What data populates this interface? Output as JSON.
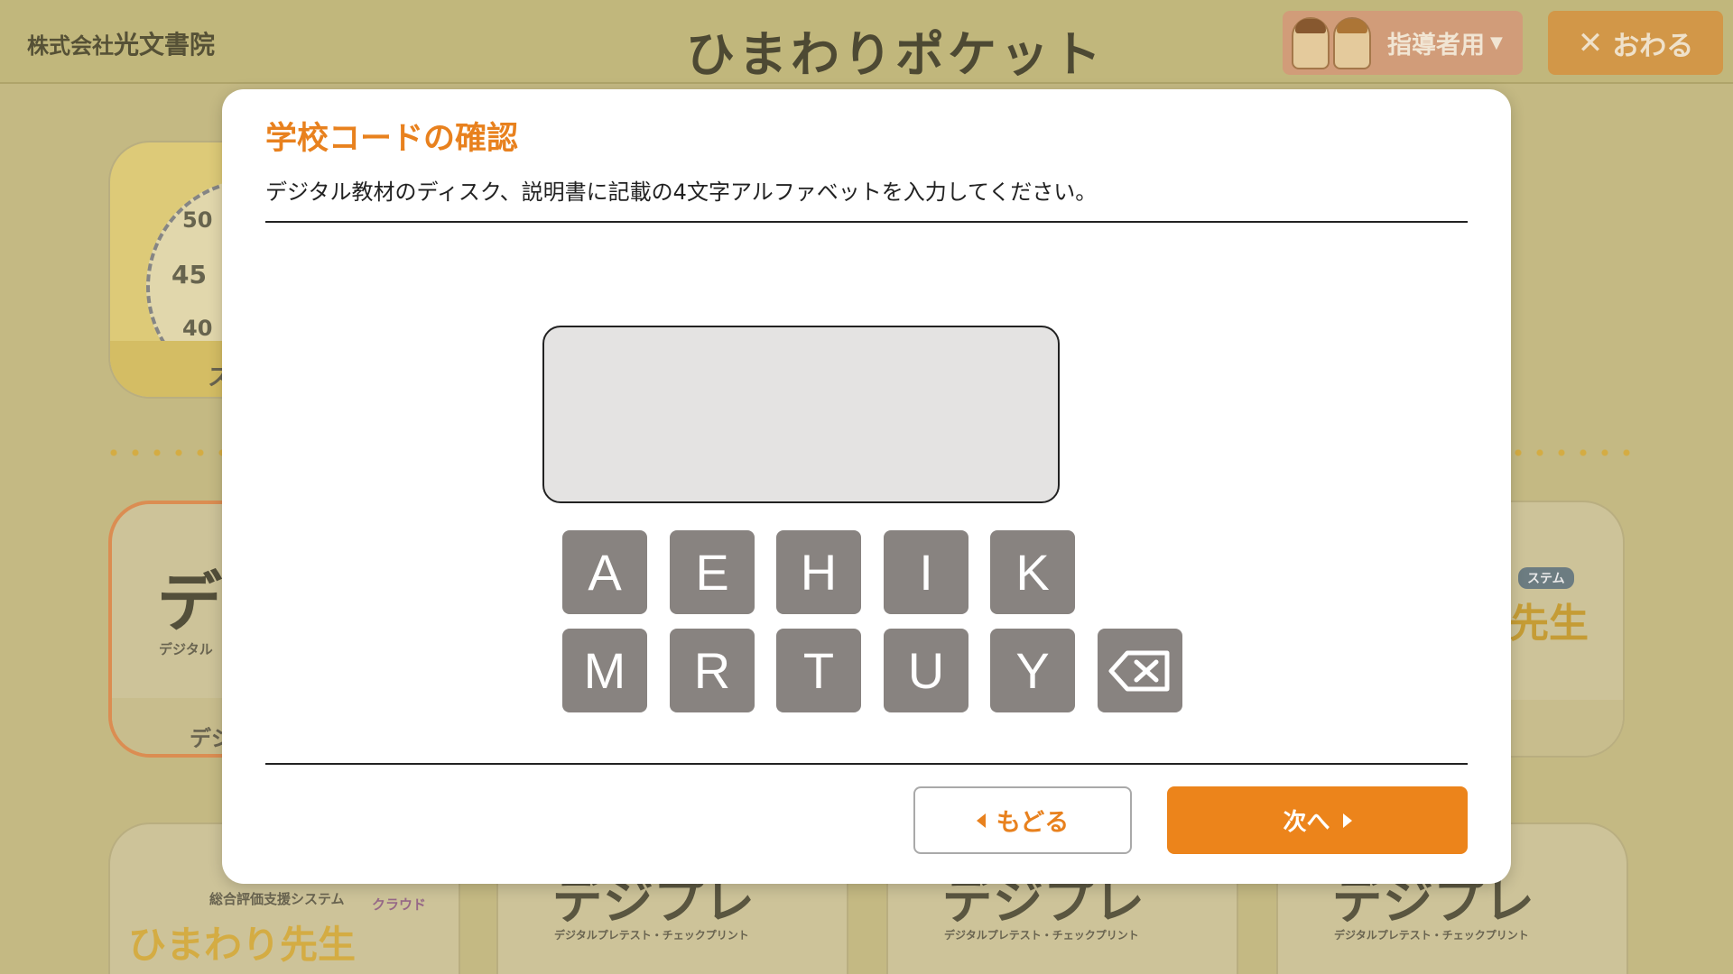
{
  "header": {
    "publisher_small": "株式会社",
    "publisher_name": "光文書院",
    "logo": "ひまわりポケット",
    "teacher_label": "指導者用",
    "close_label": "おわる"
  },
  "background": {
    "dial_labels": [
      "50",
      "45",
      "40"
    ],
    "tile_fragments": {
      "t1_band": "ス",
      "t2_big": "デ",
      "t2_sub": "デジタル",
      "t2_band": "デジ",
      "t3_label": "ステム",
      "t3_big": "先生",
      "t4_sub": "総合評価支援システム",
      "t4_cloud": "クラウド",
      "t4_big": "ひまわり先生",
      "prep_sub": "デジタルプレテスト・チェックプリント",
      "prep_big": "デジプレ"
    }
  },
  "modal": {
    "title": "学校コードの確認",
    "description": "デジタル教材のディスク、説明書に記載の4文字アルファベットを入力してください。",
    "code_value": "",
    "keys_row1": [
      "A",
      "E",
      "H",
      "I",
      "K"
    ],
    "keys_row2": [
      "M",
      "R",
      "T",
      "U",
      "Y"
    ],
    "backspace_icon": "backspace-icon",
    "back_label": "もどる",
    "next_label": "次へ"
  },
  "colors": {
    "accent": "#ec841b",
    "title": "#e8811e",
    "key": "#888380",
    "header_bg": "#c5bb7f"
  }
}
